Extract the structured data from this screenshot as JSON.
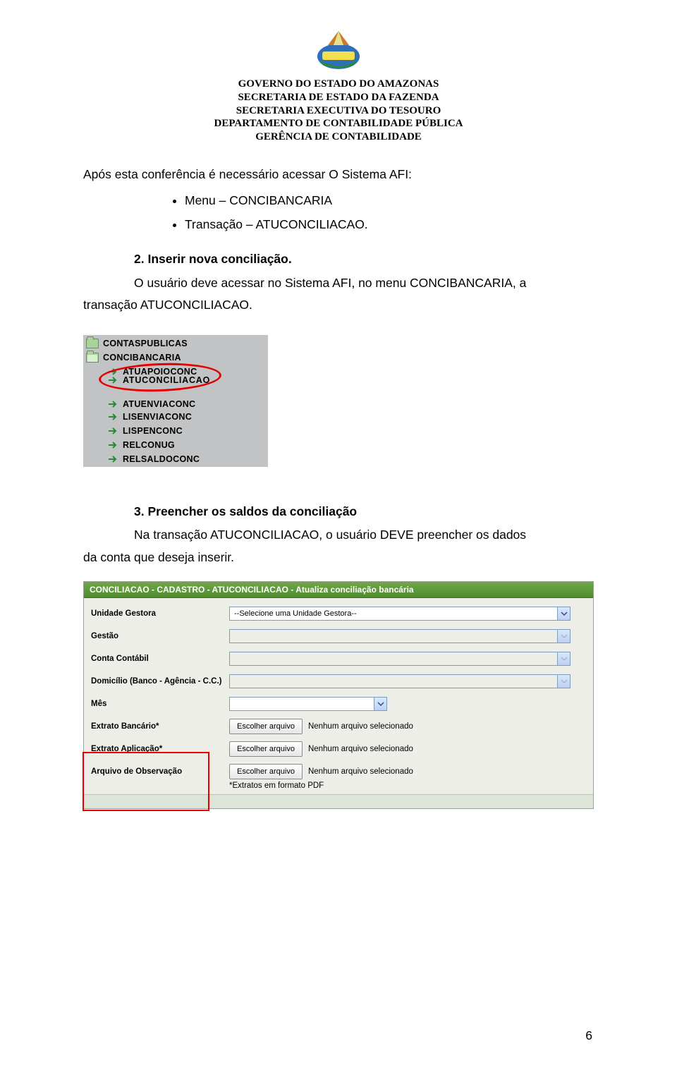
{
  "header": {
    "line1": "GOVERNO DO ESTADO DO AMAZONAS",
    "line2": "SECRETARIA DE ESTADO DA FAZENDA",
    "line3": "SECRETARIA EXECUTIVA DO TESOURO",
    "line4": "DEPARTAMENTO DE CONTABILIDADE PÚBLICA",
    "line5": "GERÊNCIA DE CONTABILIDADE"
  },
  "intro": {
    "sentence": "Após esta conferência é necessário acessar O Sistema AFI:",
    "bullets": [
      "Menu – CONCIBANCARIA",
      "Transação – ATUCONCILIACAO."
    ]
  },
  "section2": {
    "title": "2. Inserir nova conciliação.",
    "text_pre": "O usuário deve acessar no Sistema AFI, no menu CONCIBANCARIA, a",
    "text_line2": "transação ATUCONCILIACAO."
  },
  "menu": {
    "top1": "CONTASPUBLICAS",
    "top2": "CONCIBANCARIA",
    "items": [
      "ATUAPOIOCONC",
      "ATUCONCILIACAO",
      "ATUENVIACONC",
      "LISENVIACONC",
      "LISPENCONC",
      "RELCONUG",
      "RELSALDOCONC"
    ]
  },
  "section3": {
    "title": "3. Preencher os saldos da conciliação",
    "text_pre": "Na transação ATUCONCILIACAO, o usuário DEVE preencher os dados",
    "text_line2": "da conta que deseja inserir."
  },
  "form": {
    "title": "CONCILIACAO - CADASTRO - ATUCONCILIACAO - Atualiza conciliação bancária",
    "labels": {
      "ug": "Unidade Gestora",
      "gestao": "Gestão",
      "conta": "Conta Contábil",
      "domicilio": "Domicílio (Banco - Agência - C.C.)",
      "mes": "Mês",
      "extrato_bancario": "Extrato Bancário*",
      "extrato_aplicacao": "Extrato Aplicação*",
      "arquivo_obs": "Arquivo de Observação"
    },
    "select_ug_placeholder": "--Selecione uma Unidade Gestora--",
    "file_button": "Escolher arquivo",
    "file_none": "Nenhum arquivo selecionado",
    "note": "*Extratos em formato PDF"
  },
  "page_number": "6"
}
